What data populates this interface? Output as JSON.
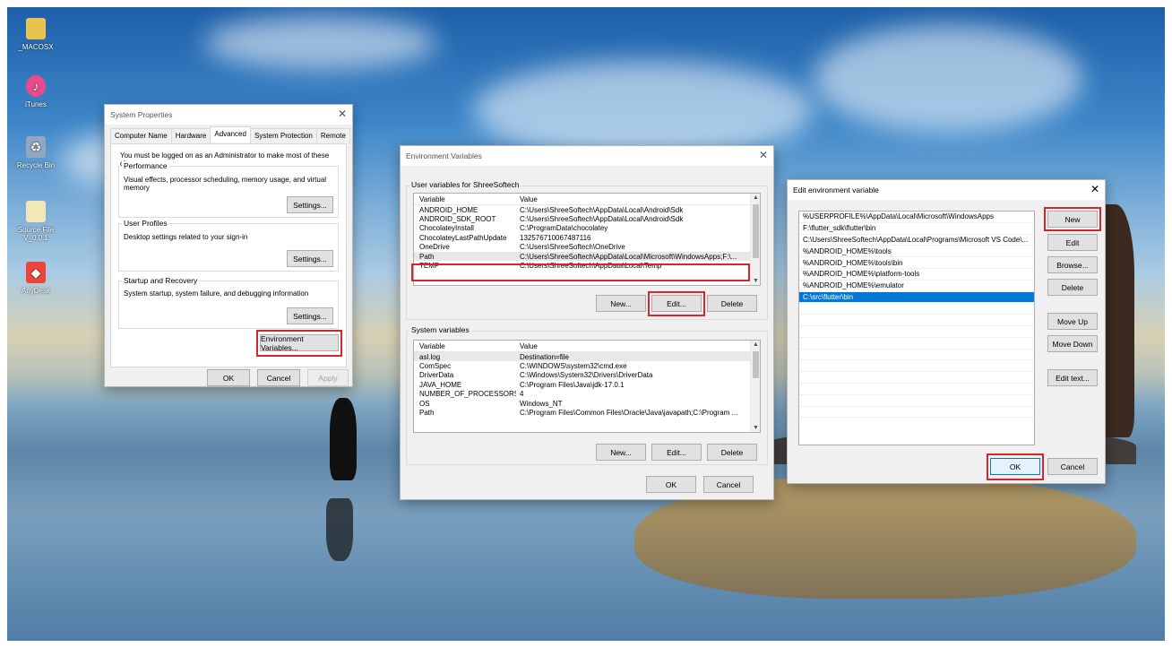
{
  "desktop": {
    "icons": [
      {
        "label": "_MACOSX",
        "icon": "folder-icon",
        "color": "#e8c44e"
      },
      {
        "label": "iTunes",
        "icon": "itunes-icon",
        "color": "#e84a8b"
      },
      {
        "label": "Recycle Bin",
        "icon": "recycle-bin-icon",
        "color": "#8fa7c2"
      },
      {
        "label": "Source File V_0.0.1",
        "icon": "folder-icon",
        "color": "#f2e7b6"
      },
      {
        "label": "AnyDesk",
        "icon": "anydesk-icon",
        "color": "#ef443b"
      }
    ]
  },
  "system_properties": {
    "title": "System Properties",
    "tabs": [
      "Computer Name",
      "Hardware",
      "Advanced",
      "System Protection",
      "Remote"
    ],
    "active_tab": "Advanced",
    "admin_note": "You must be logged on as an Administrator to make most of these changes.",
    "performance": {
      "label": "Performance",
      "description": "Visual effects, processor scheduling, memory usage, and virtual memory",
      "button": "Settings..."
    },
    "user_profiles": {
      "label": "User Profiles",
      "description": "Desktop settings related to your sign-in",
      "button": "Settings..."
    },
    "startup_recovery": {
      "label": "Startup and Recovery",
      "description": "System startup, system failure, and debugging information",
      "button": "Settings..."
    },
    "env_button": "Environment Variables...",
    "ok": "OK",
    "cancel": "Cancel",
    "apply": "Apply"
  },
  "environment_variables": {
    "title": "Environment Variables",
    "user_section": "User variables for ShreeSoftech",
    "col_variable": "Variable",
    "col_value": "Value",
    "user_vars": [
      {
        "name": "ANDROID_HOME",
        "value": "C:\\Users\\ShreeSoftech\\AppData\\Local\\Android\\Sdk"
      },
      {
        "name": "ANDROID_SDK_ROOT",
        "value": "C:\\Users\\ShreeSoftech\\AppData\\Local\\Android\\Sdk"
      },
      {
        "name": "ChocolateyInstall",
        "value": "C:\\ProgramData\\chocolatey"
      },
      {
        "name": "ChocolateyLastPathUpdate",
        "value": "132576710067487116"
      },
      {
        "name": "OneDrive",
        "value": "C:\\Users\\ShreeSoftech\\OneDrive"
      },
      {
        "name": "Path",
        "value": "C:\\Users\\ShreeSoftech\\AppData\\Local\\Microsoft\\WindowsApps;F:\\..."
      },
      {
        "name": "TEMP",
        "value": "C:\\Users\\ShreeSoftech\\AppData\\Local\\Temp"
      }
    ],
    "system_section": "System variables",
    "system_vars": [
      {
        "name": "asl.log",
        "value": "Destination=file"
      },
      {
        "name": "ComSpec",
        "value": "C:\\WINDOWS\\system32\\cmd.exe"
      },
      {
        "name": "DriverData",
        "value": "C:\\Windows\\System32\\Drivers\\DriverData"
      },
      {
        "name": "JAVA_HOME",
        "value": "C:\\Program Files\\Java\\jdk-17.0.1"
      },
      {
        "name": "NUMBER_OF_PROCESSORS",
        "value": "4"
      },
      {
        "name": "OS",
        "value": "Windows_NT"
      },
      {
        "name": "Path",
        "value": "C:\\Program Files\\Common Files\\Oracle\\Java\\javapath;C:\\Program ..."
      }
    ],
    "new": "New...",
    "edit": "Edit...",
    "delete": "Delete",
    "ok": "OK",
    "cancel": "Cancel"
  },
  "edit_env": {
    "title": "Edit environment variable",
    "paths": [
      "%USERPROFILE%\\AppData\\Local\\Microsoft\\WindowsApps",
      "F:\\flutter_sdk\\flutter\\bin",
      "C:\\Users\\ShreeSoftech\\AppData\\Local\\Programs\\Microsoft VS Code\\...",
      "%ANDROID_HOME%\\tools",
      "%ANDROID_HOME%\\tools\\bin",
      "%ANDROID_HOME%\\platform-tools",
      "%ANDROID_HOME%\\emulator",
      "C:\\src\\flutter\\bin"
    ],
    "selected_index": 7,
    "buttons": {
      "new": "New",
      "edit": "Edit",
      "browse": "Browse...",
      "delete": "Delete",
      "move_up": "Move Up",
      "move_down": "Move Down",
      "edit_text": "Edit text..."
    },
    "ok": "OK",
    "cancel": "Cancel"
  },
  "colors": {
    "highlight": "#d9232d",
    "selection": "#0078d7"
  }
}
